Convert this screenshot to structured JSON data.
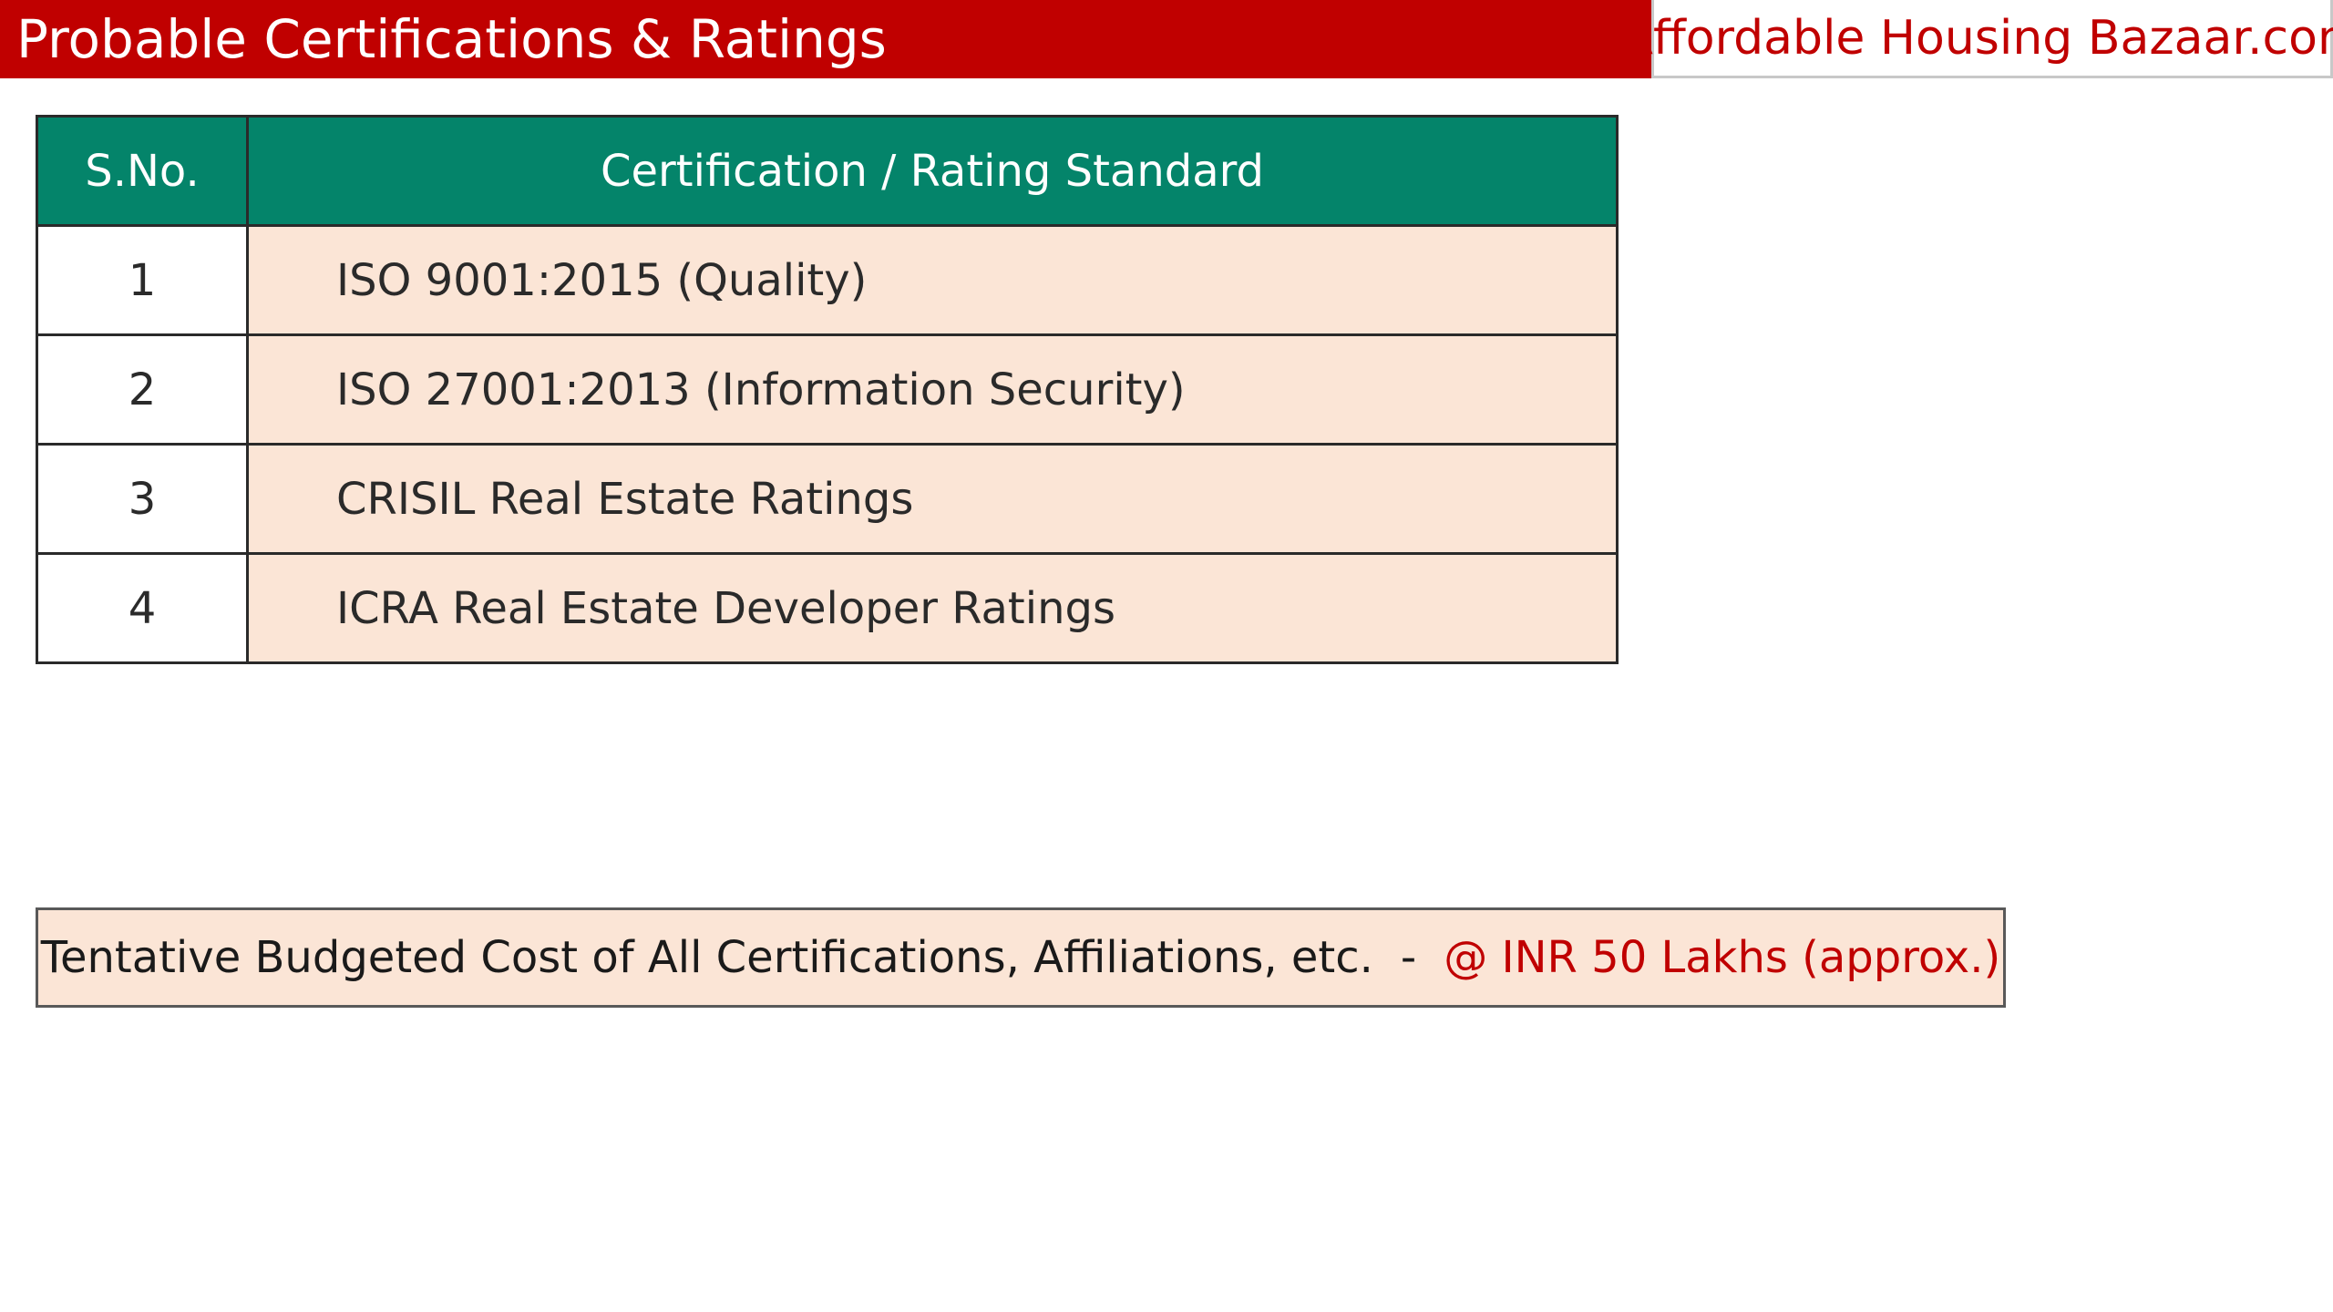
{
  "header": {
    "title": "Probable Certifications & Ratings",
    "brand": "Affordable Housing Bazaar.com"
  },
  "table": {
    "columns": [
      "S.No.",
      "Certification / Rating Standard"
    ],
    "rows": [
      {
        "sno": "1",
        "standard": "ISO 9001:2015 (Quality)"
      },
      {
        "sno": "2",
        "standard": "ISO 27001:2013 (Information Security)"
      },
      {
        "sno": "3",
        "standard": "CRISIL Real Estate Ratings"
      },
      {
        "sno": "4",
        "standard": "ICRA Real Estate Developer Ratings"
      }
    ]
  },
  "budget": {
    "label": "Tentative Budgeted Cost of All Certifications, Affiliations, etc.",
    "separator": "-",
    "value": "@ INR 50 Lakhs (approx.)"
  },
  "colors": {
    "header_red": "#c00000",
    "table_header_green": "#04846a",
    "row_peach": "#fbe5d6",
    "accent_red_text": "#c00000"
  }
}
